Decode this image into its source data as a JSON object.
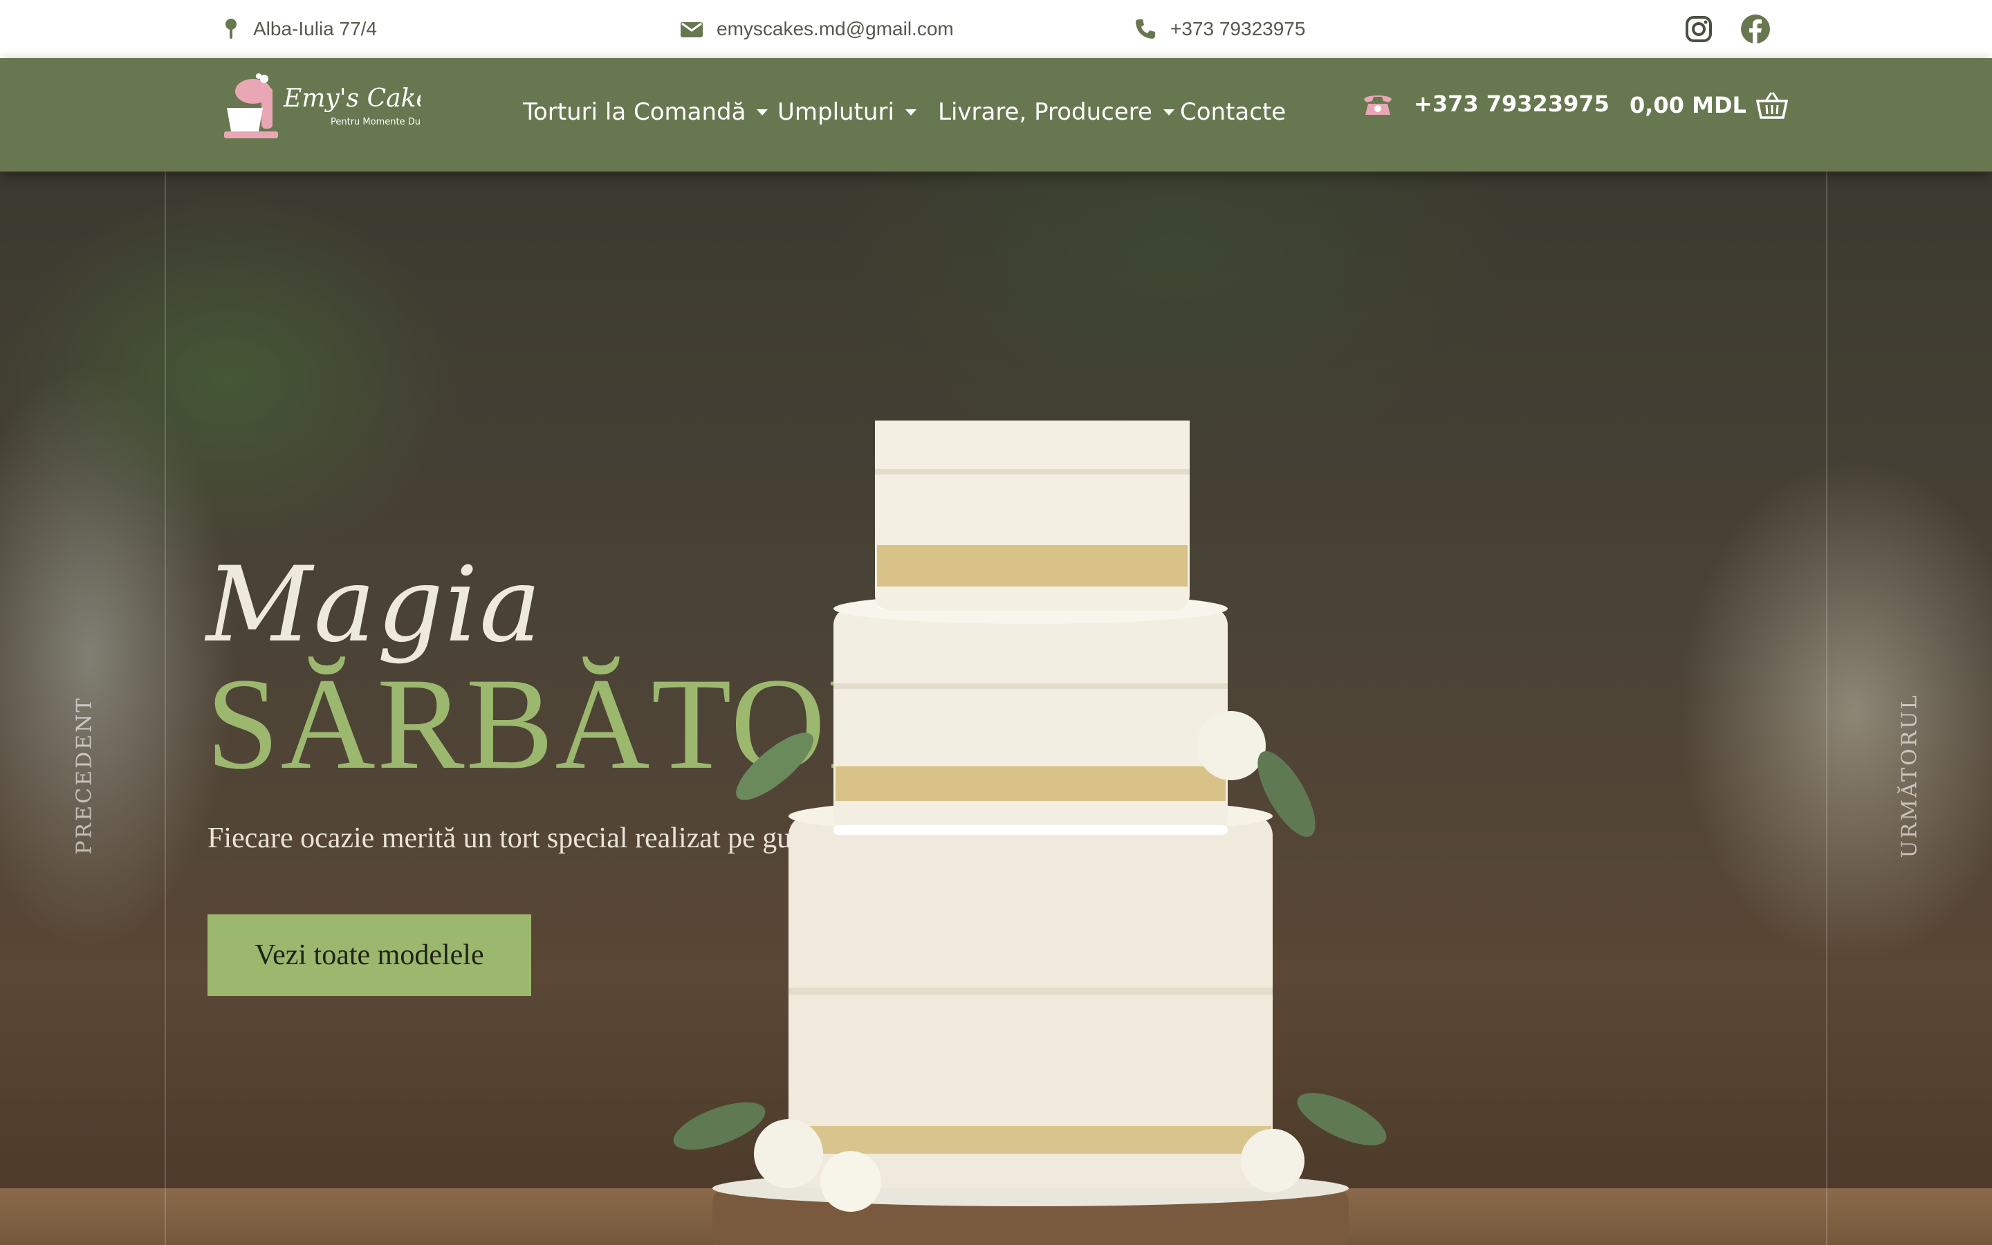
{
  "topbar": {
    "address": "Alba-Iulia 77/4",
    "email": "emyscakes.md@gmail.com",
    "phone": "+373 79323975",
    "social": [
      {
        "name": "instagram-icon"
      },
      {
        "name": "facebook-icon"
      }
    ]
  },
  "header": {
    "logo": {
      "title": "Emy's Cakes",
      "tagline": "Pentru Momente Dulci"
    },
    "nav": [
      {
        "label": "Torturi la Comandă",
        "dropdown": true
      },
      {
        "label": "Umpluturi",
        "dropdown": true
      },
      {
        "label": "Livrare, Producere",
        "dropdown": true
      },
      {
        "label": "Contacte",
        "dropdown": false
      }
    ],
    "phone": "+373 79323975",
    "cart": "0,00 MDL"
  },
  "hero": {
    "script_title": "Magia",
    "title": "SĂRBĂTORII",
    "subtitle": "Fiecare ocazie merită un tort special realizat pe gustul tău",
    "cta": "Vezi toate modelele",
    "prev": "PRECEDENT",
    "next": "URMĂTORUL"
  },
  "colors": {
    "brand_green": "#67774f",
    "accent_green": "#9cb86f",
    "pink": "#e9a7b6"
  }
}
